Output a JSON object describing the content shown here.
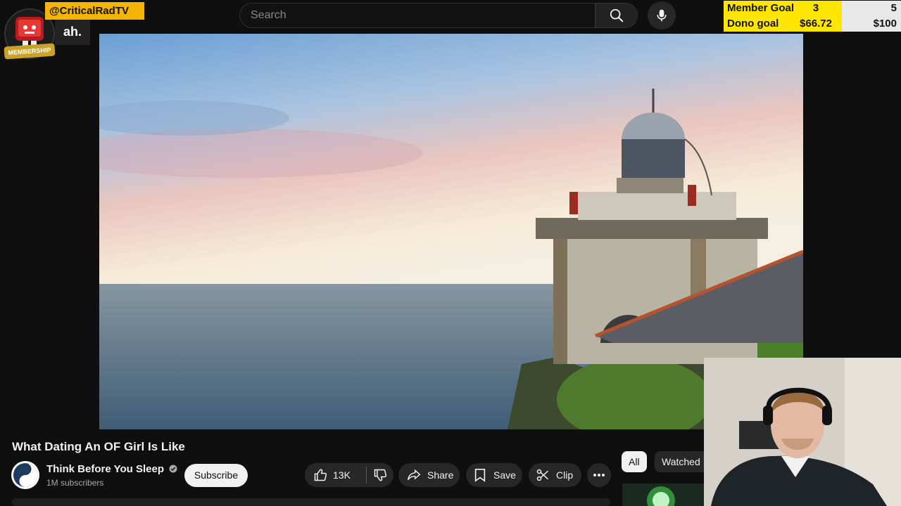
{
  "header": {
    "search_placeholder": "Search",
    "search_icon": "search-icon",
    "mic_icon": "mic-icon"
  },
  "overlay": {
    "handle": "@CriticalRadTV",
    "chat_message": "ah.",
    "membership_label": "MEMBERSHIP",
    "goals": {
      "member_label": "Member Goal",
      "member_current": "3",
      "member_target": "5",
      "dono_label": "Dono goal",
      "dono_current": "$66.72",
      "dono_target": "$100"
    }
  },
  "video": {
    "title": "What Dating An OF Girl Is Like",
    "channel_name": "Think Before You Sleep",
    "subscribers": "1M subscribers",
    "subscribe_label": "Subscribe",
    "like_count": "13K",
    "share_label": "Share",
    "save_label": "Save",
    "clip_label": "Clip"
  },
  "chips": {
    "all": "All",
    "watched": "Watched"
  },
  "colors": {
    "background": "#0f0f0f",
    "goal_yellow": "#ffe600",
    "handle_orange": "#f4b400"
  }
}
